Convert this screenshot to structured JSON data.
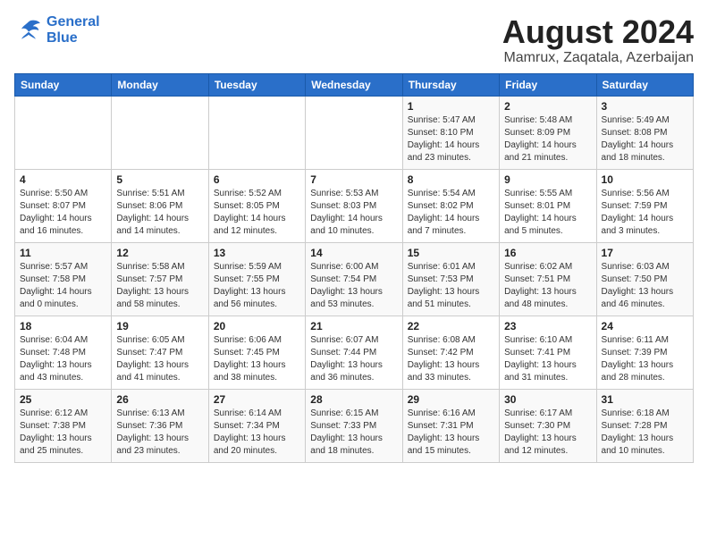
{
  "logo": {
    "line1": "General",
    "line2": "Blue"
  },
  "title": "August 2024",
  "subtitle": "Mamrux, Zaqatala, Azerbaijan",
  "weekdays": [
    "Sunday",
    "Monday",
    "Tuesday",
    "Wednesday",
    "Thursday",
    "Friday",
    "Saturday"
  ],
  "weeks": [
    [
      {
        "day": "",
        "info": ""
      },
      {
        "day": "",
        "info": ""
      },
      {
        "day": "",
        "info": ""
      },
      {
        "day": "",
        "info": ""
      },
      {
        "day": "1",
        "info": "Sunrise: 5:47 AM\nSunset: 8:10 PM\nDaylight: 14 hours\nand 23 minutes."
      },
      {
        "day": "2",
        "info": "Sunrise: 5:48 AM\nSunset: 8:09 PM\nDaylight: 14 hours\nand 21 minutes."
      },
      {
        "day": "3",
        "info": "Sunrise: 5:49 AM\nSunset: 8:08 PM\nDaylight: 14 hours\nand 18 minutes."
      }
    ],
    [
      {
        "day": "4",
        "info": "Sunrise: 5:50 AM\nSunset: 8:07 PM\nDaylight: 14 hours\nand 16 minutes."
      },
      {
        "day": "5",
        "info": "Sunrise: 5:51 AM\nSunset: 8:06 PM\nDaylight: 14 hours\nand 14 minutes."
      },
      {
        "day": "6",
        "info": "Sunrise: 5:52 AM\nSunset: 8:05 PM\nDaylight: 14 hours\nand 12 minutes."
      },
      {
        "day": "7",
        "info": "Sunrise: 5:53 AM\nSunset: 8:03 PM\nDaylight: 14 hours\nand 10 minutes."
      },
      {
        "day": "8",
        "info": "Sunrise: 5:54 AM\nSunset: 8:02 PM\nDaylight: 14 hours\nand 7 minutes."
      },
      {
        "day": "9",
        "info": "Sunrise: 5:55 AM\nSunset: 8:01 PM\nDaylight: 14 hours\nand 5 minutes."
      },
      {
        "day": "10",
        "info": "Sunrise: 5:56 AM\nSunset: 7:59 PM\nDaylight: 14 hours\nand 3 minutes."
      }
    ],
    [
      {
        "day": "11",
        "info": "Sunrise: 5:57 AM\nSunset: 7:58 PM\nDaylight: 14 hours\nand 0 minutes."
      },
      {
        "day": "12",
        "info": "Sunrise: 5:58 AM\nSunset: 7:57 PM\nDaylight: 13 hours\nand 58 minutes."
      },
      {
        "day": "13",
        "info": "Sunrise: 5:59 AM\nSunset: 7:55 PM\nDaylight: 13 hours\nand 56 minutes."
      },
      {
        "day": "14",
        "info": "Sunrise: 6:00 AM\nSunset: 7:54 PM\nDaylight: 13 hours\nand 53 minutes."
      },
      {
        "day": "15",
        "info": "Sunrise: 6:01 AM\nSunset: 7:53 PM\nDaylight: 13 hours\nand 51 minutes."
      },
      {
        "day": "16",
        "info": "Sunrise: 6:02 AM\nSunset: 7:51 PM\nDaylight: 13 hours\nand 48 minutes."
      },
      {
        "day": "17",
        "info": "Sunrise: 6:03 AM\nSunset: 7:50 PM\nDaylight: 13 hours\nand 46 minutes."
      }
    ],
    [
      {
        "day": "18",
        "info": "Sunrise: 6:04 AM\nSunset: 7:48 PM\nDaylight: 13 hours\nand 43 minutes."
      },
      {
        "day": "19",
        "info": "Sunrise: 6:05 AM\nSunset: 7:47 PM\nDaylight: 13 hours\nand 41 minutes."
      },
      {
        "day": "20",
        "info": "Sunrise: 6:06 AM\nSunset: 7:45 PM\nDaylight: 13 hours\nand 38 minutes."
      },
      {
        "day": "21",
        "info": "Sunrise: 6:07 AM\nSunset: 7:44 PM\nDaylight: 13 hours\nand 36 minutes."
      },
      {
        "day": "22",
        "info": "Sunrise: 6:08 AM\nSunset: 7:42 PM\nDaylight: 13 hours\nand 33 minutes."
      },
      {
        "day": "23",
        "info": "Sunrise: 6:10 AM\nSunset: 7:41 PM\nDaylight: 13 hours\nand 31 minutes."
      },
      {
        "day": "24",
        "info": "Sunrise: 6:11 AM\nSunset: 7:39 PM\nDaylight: 13 hours\nand 28 minutes."
      }
    ],
    [
      {
        "day": "25",
        "info": "Sunrise: 6:12 AM\nSunset: 7:38 PM\nDaylight: 13 hours\nand 25 minutes."
      },
      {
        "day": "26",
        "info": "Sunrise: 6:13 AM\nSunset: 7:36 PM\nDaylight: 13 hours\nand 23 minutes."
      },
      {
        "day": "27",
        "info": "Sunrise: 6:14 AM\nSunset: 7:34 PM\nDaylight: 13 hours\nand 20 minutes."
      },
      {
        "day": "28",
        "info": "Sunrise: 6:15 AM\nSunset: 7:33 PM\nDaylight: 13 hours\nand 18 minutes."
      },
      {
        "day": "29",
        "info": "Sunrise: 6:16 AM\nSunset: 7:31 PM\nDaylight: 13 hours\nand 15 minutes."
      },
      {
        "day": "30",
        "info": "Sunrise: 6:17 AM\nSunset: 7:30 PM\nDaylight: 13 hours\nand 12 minutes."
      },
      {
        "day": "31",
        "info": "Sunrise: 6:18 AM\nSunset: 7:28 PM\nDaylight: 13 hours\nand 10 minutes."
      }
    ]
  ]
}
